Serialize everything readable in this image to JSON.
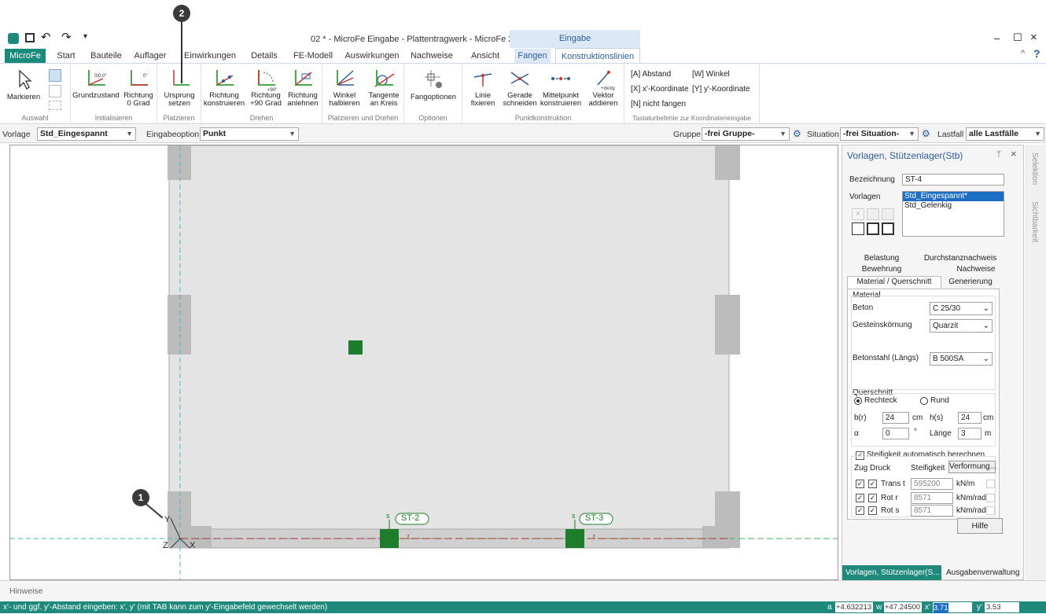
{
  "window": {
    "title": "02 * - MicroFe Eingabe - Plattentragwerk - MicroFe 2018",
    "context_group": "Eingabe",
    "help_icon": "?"
  },
  "ribbon_tabs": [
    "Start",
    "Bauteile",
    "Auflager",
    "Einwirkungen",
    "Details",
    "FE-Modell",
    "Auswirkungen",
    "Nachweise",
    "Ansicht",
    "Fangen",
    "Konstruktionslinien"
  ],
  "app_tab": "MicroFe",
  "groups": {
    "auswahl": {
      "label": "Auswahl",
      "markieren": "Markieren"
    },
    "initialisieren": {
      "label": "Initialisieren",
      "grundzustand": "Grundzustand",
      "richtung0_a": "Richtung",
      "richtung0_b": "0 Grad",
      "grund_icon": "0|0,0°",
      "richtung_icon": "0°"
    },
    "platzieren": {
      "label": "Platzieren",
      "ursprung_a": "Ursprung",
      "ursprung_b": "setzen"
    },
    "drehen": {
      "label": "Drehen",
      "konstr_a": "Richtung",
      "konstr_b": "konstruieren",
      "plus90_a": "Richtung",
      "plus90_b": "+90 Grad",
      "plus90_icon": "+90°",
      "anlehnen_a": "Richtung",
      "anlehnen_b": "anlehnen"
    },
    "platz_drehen": {
      "label": "Platzieren und Drehen",
      "winkel_a": "Winkel",
      "winkel_b": "halbieren",
      "tangente_a": "Tangente",
      "tangente_b": "an Kreis"
    },
    "optionen": {
      "label": "Optionen",
      "fang": "Fangoptionen"
    },
    "punktkonstruktion": {
      "label": "Punktkonstruktion",
      "linie_a": "Linie",
      "linie_b": "fixieren",
      "gerade_a": "Gerade",
      "gerade_b": "schneiden",
      "mittel_a": "Mittelpunkt",
      "mittel_b": "konstruieren",
      "vektor_a": "Vektor",
      "vektor_b": "addieren",
      "vektor_icon": "+dx/dy"
    },
    "tastatur": {
      "label": "Tastaturbefehle zur Koordinateneingabe",
      "a": "[A] Abstand",
      "w": "[W] Winkel",
      "x": "[X] x'-Koordinate",
      "y": "[Y] y'-Koordinate",
      "n": "[N] nicht fangen"
    }
  },
  "optbar": {
    "vorlage_label": "Vorlage",
    "vorlage_value": "Std_Eingespannt",
    "eingabe_label": "Eingabeoption",
    "eingabe_value": "Punkt",
    "gruppe_label": "Gruppe",
    "gruppe_value": "-frei Gruppe-",
    "situation_label": "Situation",
    "situation_value": "-frei Situation-",
    "lastfall_label": "Lastfall",
    "lastfall_value": "alle Lastfälle"
  },
  "canvas": {
    "st2": "ST-2",
    "st3": "ST-3",
    "s": "s",
    "r": "r",
    "y": "Y",
    "x": "X",
    "z": "Z",
    "badge1": "1",
    "badge2": "2"
  },
  "panel": {
    "title": "Vorlagen, Stützenlager(Stb)",
    "pin": "ᛘ",
    "close": "×",
    "bez_label": "Bezeichnung",
    "bez_value": "ST-4",
    "vorlagen_label": "Vorlagen",
    "vorlagen_items": [
      "Std_Eingespannt*",
      "Std_Gelenkig"
    ],
    "tabs_row1": [
      "Belastung",
      "Durchstanznachweis"
    ],
    "tabs_row2": [
      "Bewehrung",
      "Nachweise"
    ],
    "tabs_row3": [
      "Material / Querschnitt",
      "Generierung"
    ],
    "material_title": "Material",
    "beton_label": "Beton",
    "beton_value": "C 25/30",
    "gestein_label": "Gesteinskörnung",
    "gestein_value": "Quarzit",
    "stahl_label": "Betonstahl (Längs)",
    "stahl_value": "B 500SA",
    "quer_title": "Querschnitt",
    "rechteck": "Rechteck",
    "rund": "Rund",
    "br_label": "b(r)",
    "br_value": "24",
    "hs_label": "h(s)",
    "hs_value": "24",
    "cm": "cm",
    "alpha_label": "α",
    "alpha_value": "0",
    "deg": "°",
    "laenge_label": "Länge",
    "laenge_value": "3",
    "m": "m",
    "steif_check": "Steifigkeit automatisch berechnen",
    "zug": "Zug",
    "druck": "Druck",
    "steif_col": "Steifigkeit",
    "verformung": "Verformung...",
    "rows": [
      {
        "name": "Trans t",
        "value": "595200",
        "unit": "kN/m"
      },
      {
        "name": "Rot r",
        "value": "8571",
        "unit": "kNm/rad"
      },
      {
        "name": "Rot s",
        "value": "8571",
        "unit": "kNm/rad"
      }
    ],
    "hilfe": "Hilfe",
    "bottom_tab1": "Vorlagen, Stützenlager(S...",
    "bottom_tab2": "Ausgabenverwaltung"
  },
  "sidetabs": {
    "selektion": "Selektion",
    "sichtbarkeit": "Sichtbarkeit"
  },
  "hinweise": "Hinweise",
  "status": {
    "text": "x'- und ggf. y'-Abstand eingeben: x', y' (mit TAB kann zum y'-Eingabefeld gewechselt werden)",
    "a_label": "a",
    "a_value": "+4.632213",
    "w_label": "w",
    "w_value": "+47.24500",
    "x_label": "x'",
    "x_value": "3.71",
    "y_label": "y'",
    "y_value": "3.53"
  },
  "colors": {
    "accent": "#1f8a7c",
    "support": "#1e7d2a",
    "context": "#2e5d9a"
  }
}
